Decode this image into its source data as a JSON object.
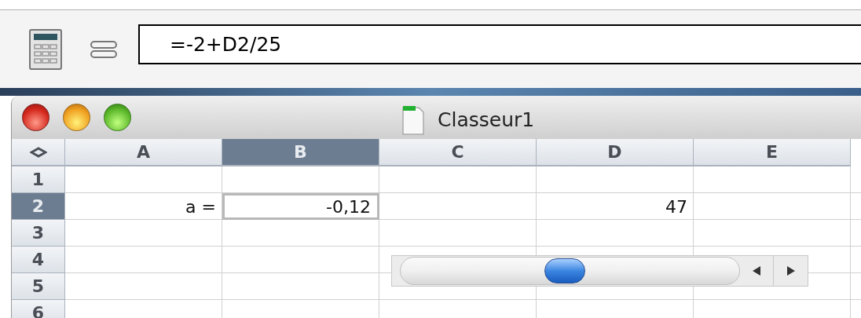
{
  "formula_bar": {
    "value": "=-2+D2/25"
  },
  "window": {
    "title": "Classeur1"
  },
  "sheet": {
    "columns": [
      {
        "label": "A",
        "selected": false
      },
      {
        "label": "B",
        "selected": true
      },
      {
        "label": "C",
        "selected": false
      },
      {
        "label": "D",
        "selected": false
      },
      {
        "label": "E",
        "selected": false
      }
    ],
    "rows": [
      {
        "label": "1",
        "selected": false,
        "cells": [
          {
            "selected": false
          },
          {
            "selected": false
          },
          {
            "selected": false
          },
          {
            "selected": false
          },
          {
            "selected": false
          }
        ]
      },
      {
        "label": "2",
        "selected": true,
        "cells": [
          {
            "value": "a =",
            "selected": false
          },
          {
            "value": "-0,12",
            "selected": true
          },
          {
            "selected": false
          },
          {
            "value": "47",
            "selected": false
          },
          {
            "selected": false
          }
        ]
      },
      {
        "label": "3",
        "selected": false,
        "cells": [
          {
            "selected": false
          },
          {
            "selected": false
          },
          {
            "selected": false
          },
          {
            "selected": false
          },
          {
            "selected": false
          }
        ]
      },
      {
        "label": "4",
        "selected": false,
        "cells": [
          {
            "selected": false
          },
          {
            "selected": false
          },
          {
            "selected": false
          },
          {
            "selected": false
          },
          {
            "selected": false
          }
        ]
      },
      {
        "label": "5",
        "selected": false,
        "cells": [
          {
            "selected": false
          },
          {
            "selected": false
          },
          {
            "selected": false
          },
          {
            "selected": false
          },
          {
            "selected": false
          }
        ]
      },
      {
        "label": "6",
        "selected": false,
        "cells": [
          {
            "selected": false
          },
          {
            "selected": false
          },
          {
            "selected": false
          },
          {
            "selected": false
          },
          {
            "selected": false
          }
        ]
      }
    ]
  },
  "slider": {
    "level": 0.47
  }
}
